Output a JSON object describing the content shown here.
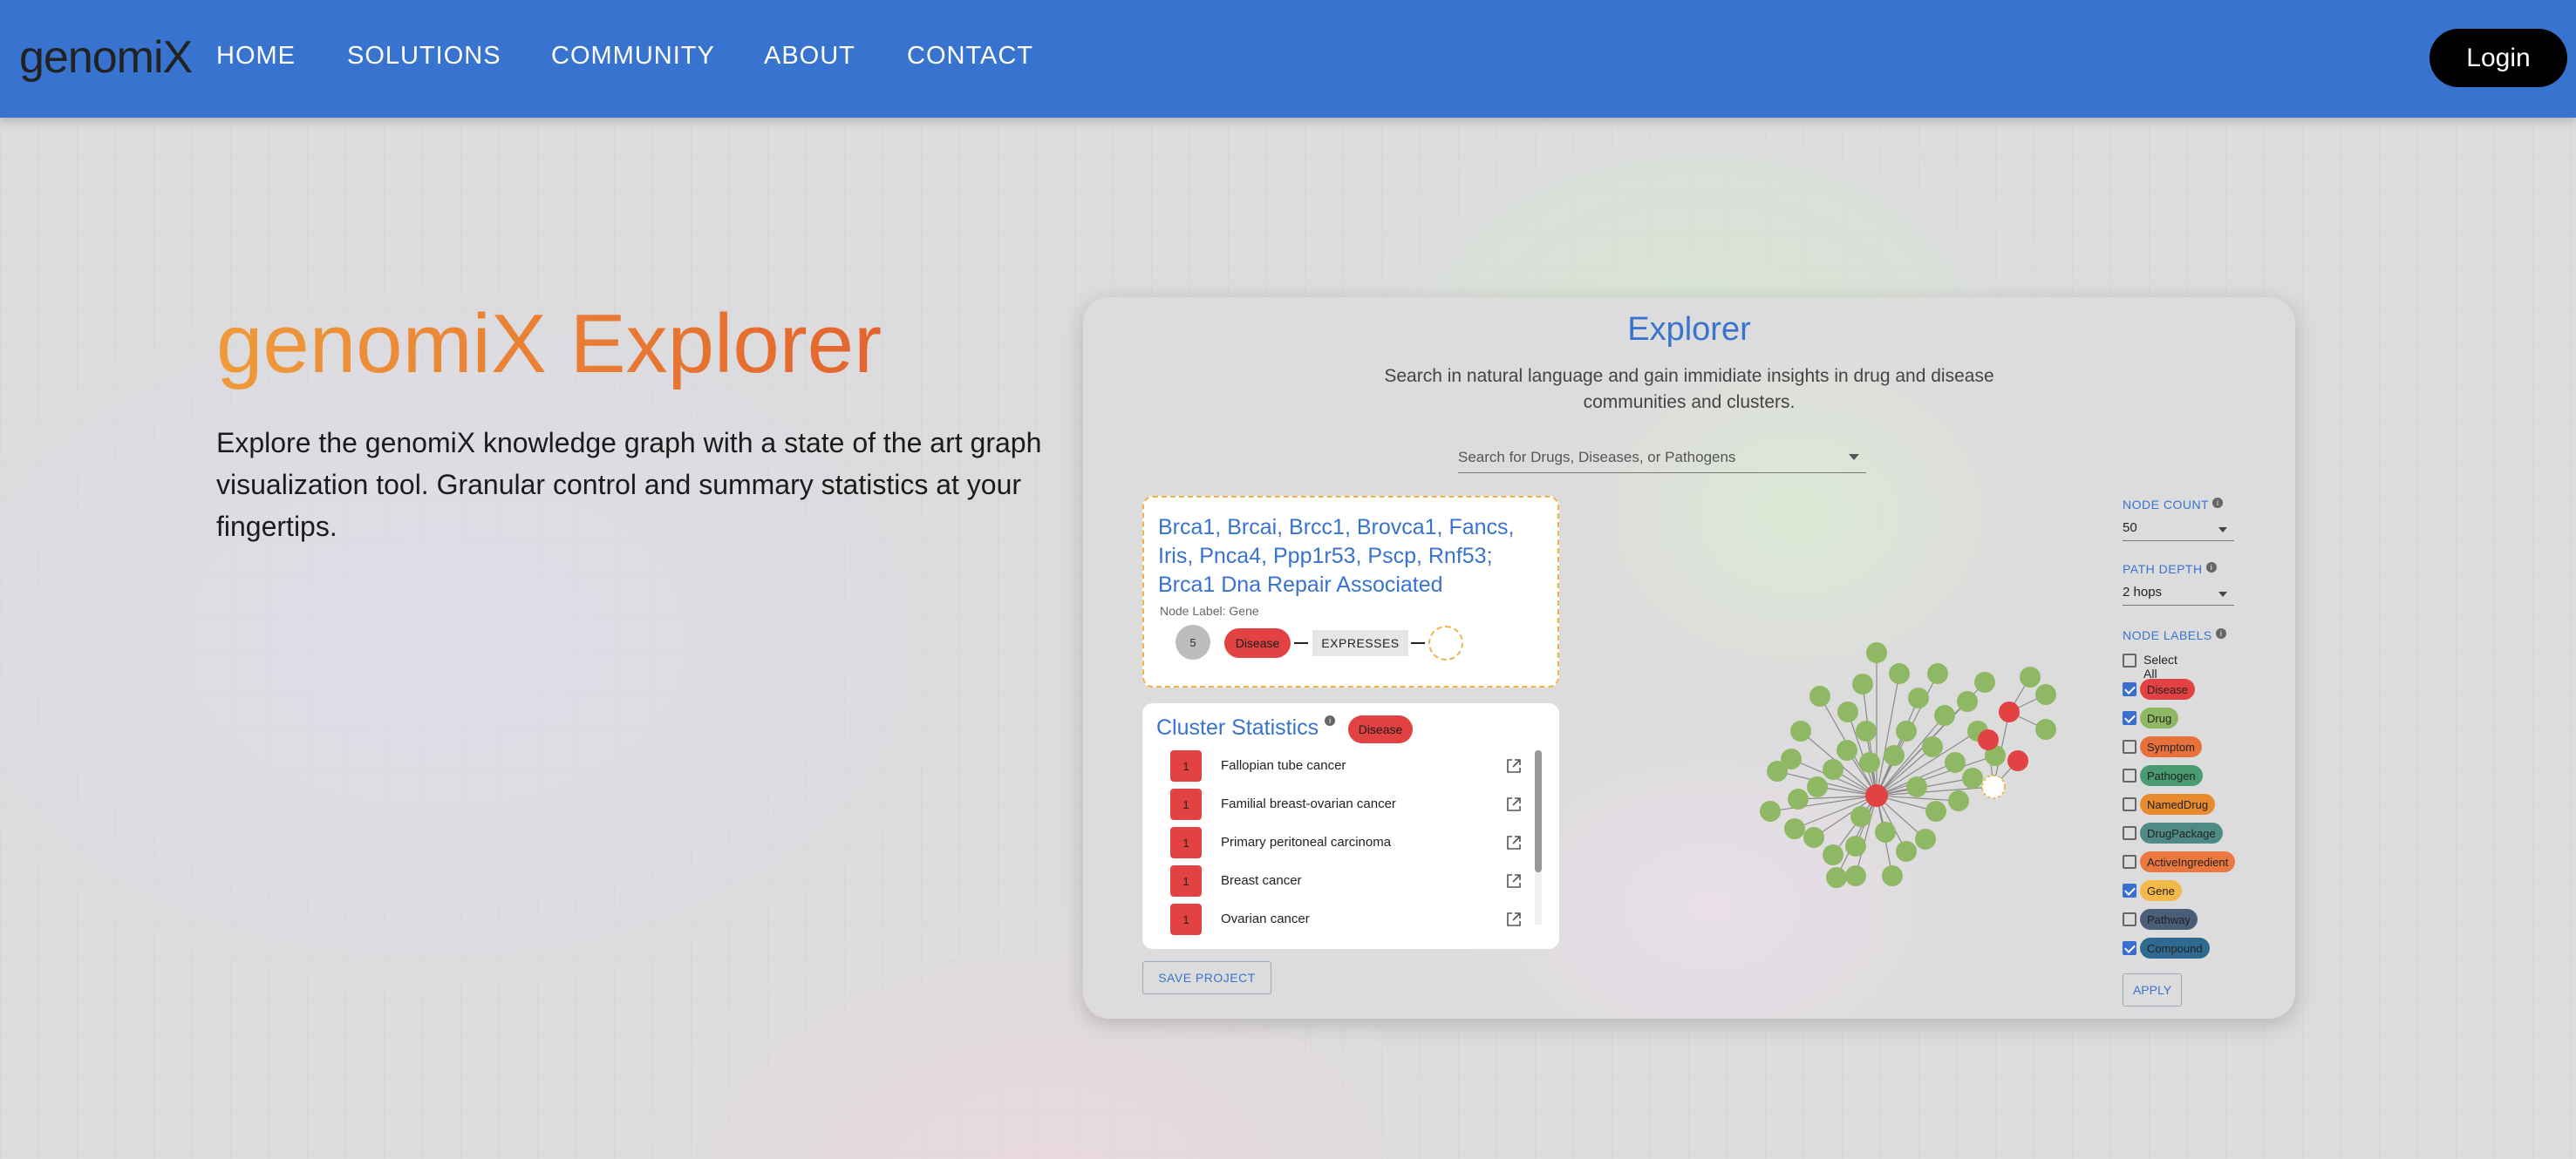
{
  "nav": {
    "logo": "genomiX",
    "links": [
      "HOME",
      "SOLUTIONS",
      "COMMUNITY",
      "ABOUT",
      "CONTACT"
    ],
    "login": "Login",
    "bg_color": "#3873cf"
  },
  "hero": {
    "title": "genomiX Explorer",
    "description": "Explore the genomiX knowledge graph with a state of the art graph visualization tool. Granular control and summary statistics at your fingertips."
  },
  "explorer": {
    "title": "Explorer",
    "subtitle": "Search in natural language and gain immidiate insights in drug and disease communities and clusters.",
    "search_placeholder": "Search for Drugs, Diseases, or Pathogens",
    "node_card": {
      "title": "Brca1, Brcai, Brcc1, Brovca1, Fancs, Iris, Pnca4, Ppp1r53, Pscp, Rnf53; Brca1 Dna Repair Associated",
      "node_label": "Node Label: Gene",
      "count": "5",
      "chip": "Disease",
      "relation": "EXPRESSES"
    },
    "cluster": {
      "title": "Cluster Statistics",
      "chip": "Disease",
      "rows": [
        {
          "count": "1",
          "name": "Fallopian tube cancer"
        },
        {
          "count": "1",
          "name": "Familial breast-ovarian cancer"
        },
        {
          "count": "1",
          "name": "Primary peritoneal carcinoma"
        },
        {
          "count": "1",
          "name": "Breast cancer"
        },
        {
          "count": "1",
          "name": "Ovarian cancer"
        }
      ]
    },
    "save_button": "SAVE PROJECT",
    "controls": {
      "node_count_label": "NODE COUNT",
      "node_count_value": "50",
      "path_depth_label": "PATH DEPTH",
      "path_depth_value": "2 hops",
      "node_labels_label": "NODE LABELS",
      "labels": [
        {
          "name": "Select All",
          "checked": false,
          "color": ""
        },
        {
          "name": "Disease",
          "checked": true,
          "color": "#e34242"
        },
        {
          "name": "Drug",
          "checked": true,
          "color": "#8fb864"
        },
        {
          "name": "Symptom",
          "checked": false,
          "color": "#e8703a"
        },
        {
          "name": "Pathogen",
          "checked": false,
          "color": "#4a9a72"
        },
        {
          "name": "NamedDrug",
          "checked": false,
          "color": "#e88a2e"
        },
        {
          "name": "DrugPackage",
          "checked": false,
          "color": "#4f8a86"
        },
        {
          "name": "ActiveIngredient",
          "checked": false,
          "color": "#ea7840"
        },
        {
          "name": "Gene",
          "checked": true,
          "color": "#f2b84a"
        },
        {
          "name": "Pathway",
          "checked": false,
          "color": "#4a5e7a"
        },
        {
          "name": "Compound",
          "checked": true,
          "color": "#2f6a90"
        }
      ],
      "apply": "APPLY"
    },
    "colors": {
      "accent": "#3873cf",
      "disease": "#e34242",
      "drug": "#8fb864",
      "gene": "#f2b84a"
    }
  }
}
